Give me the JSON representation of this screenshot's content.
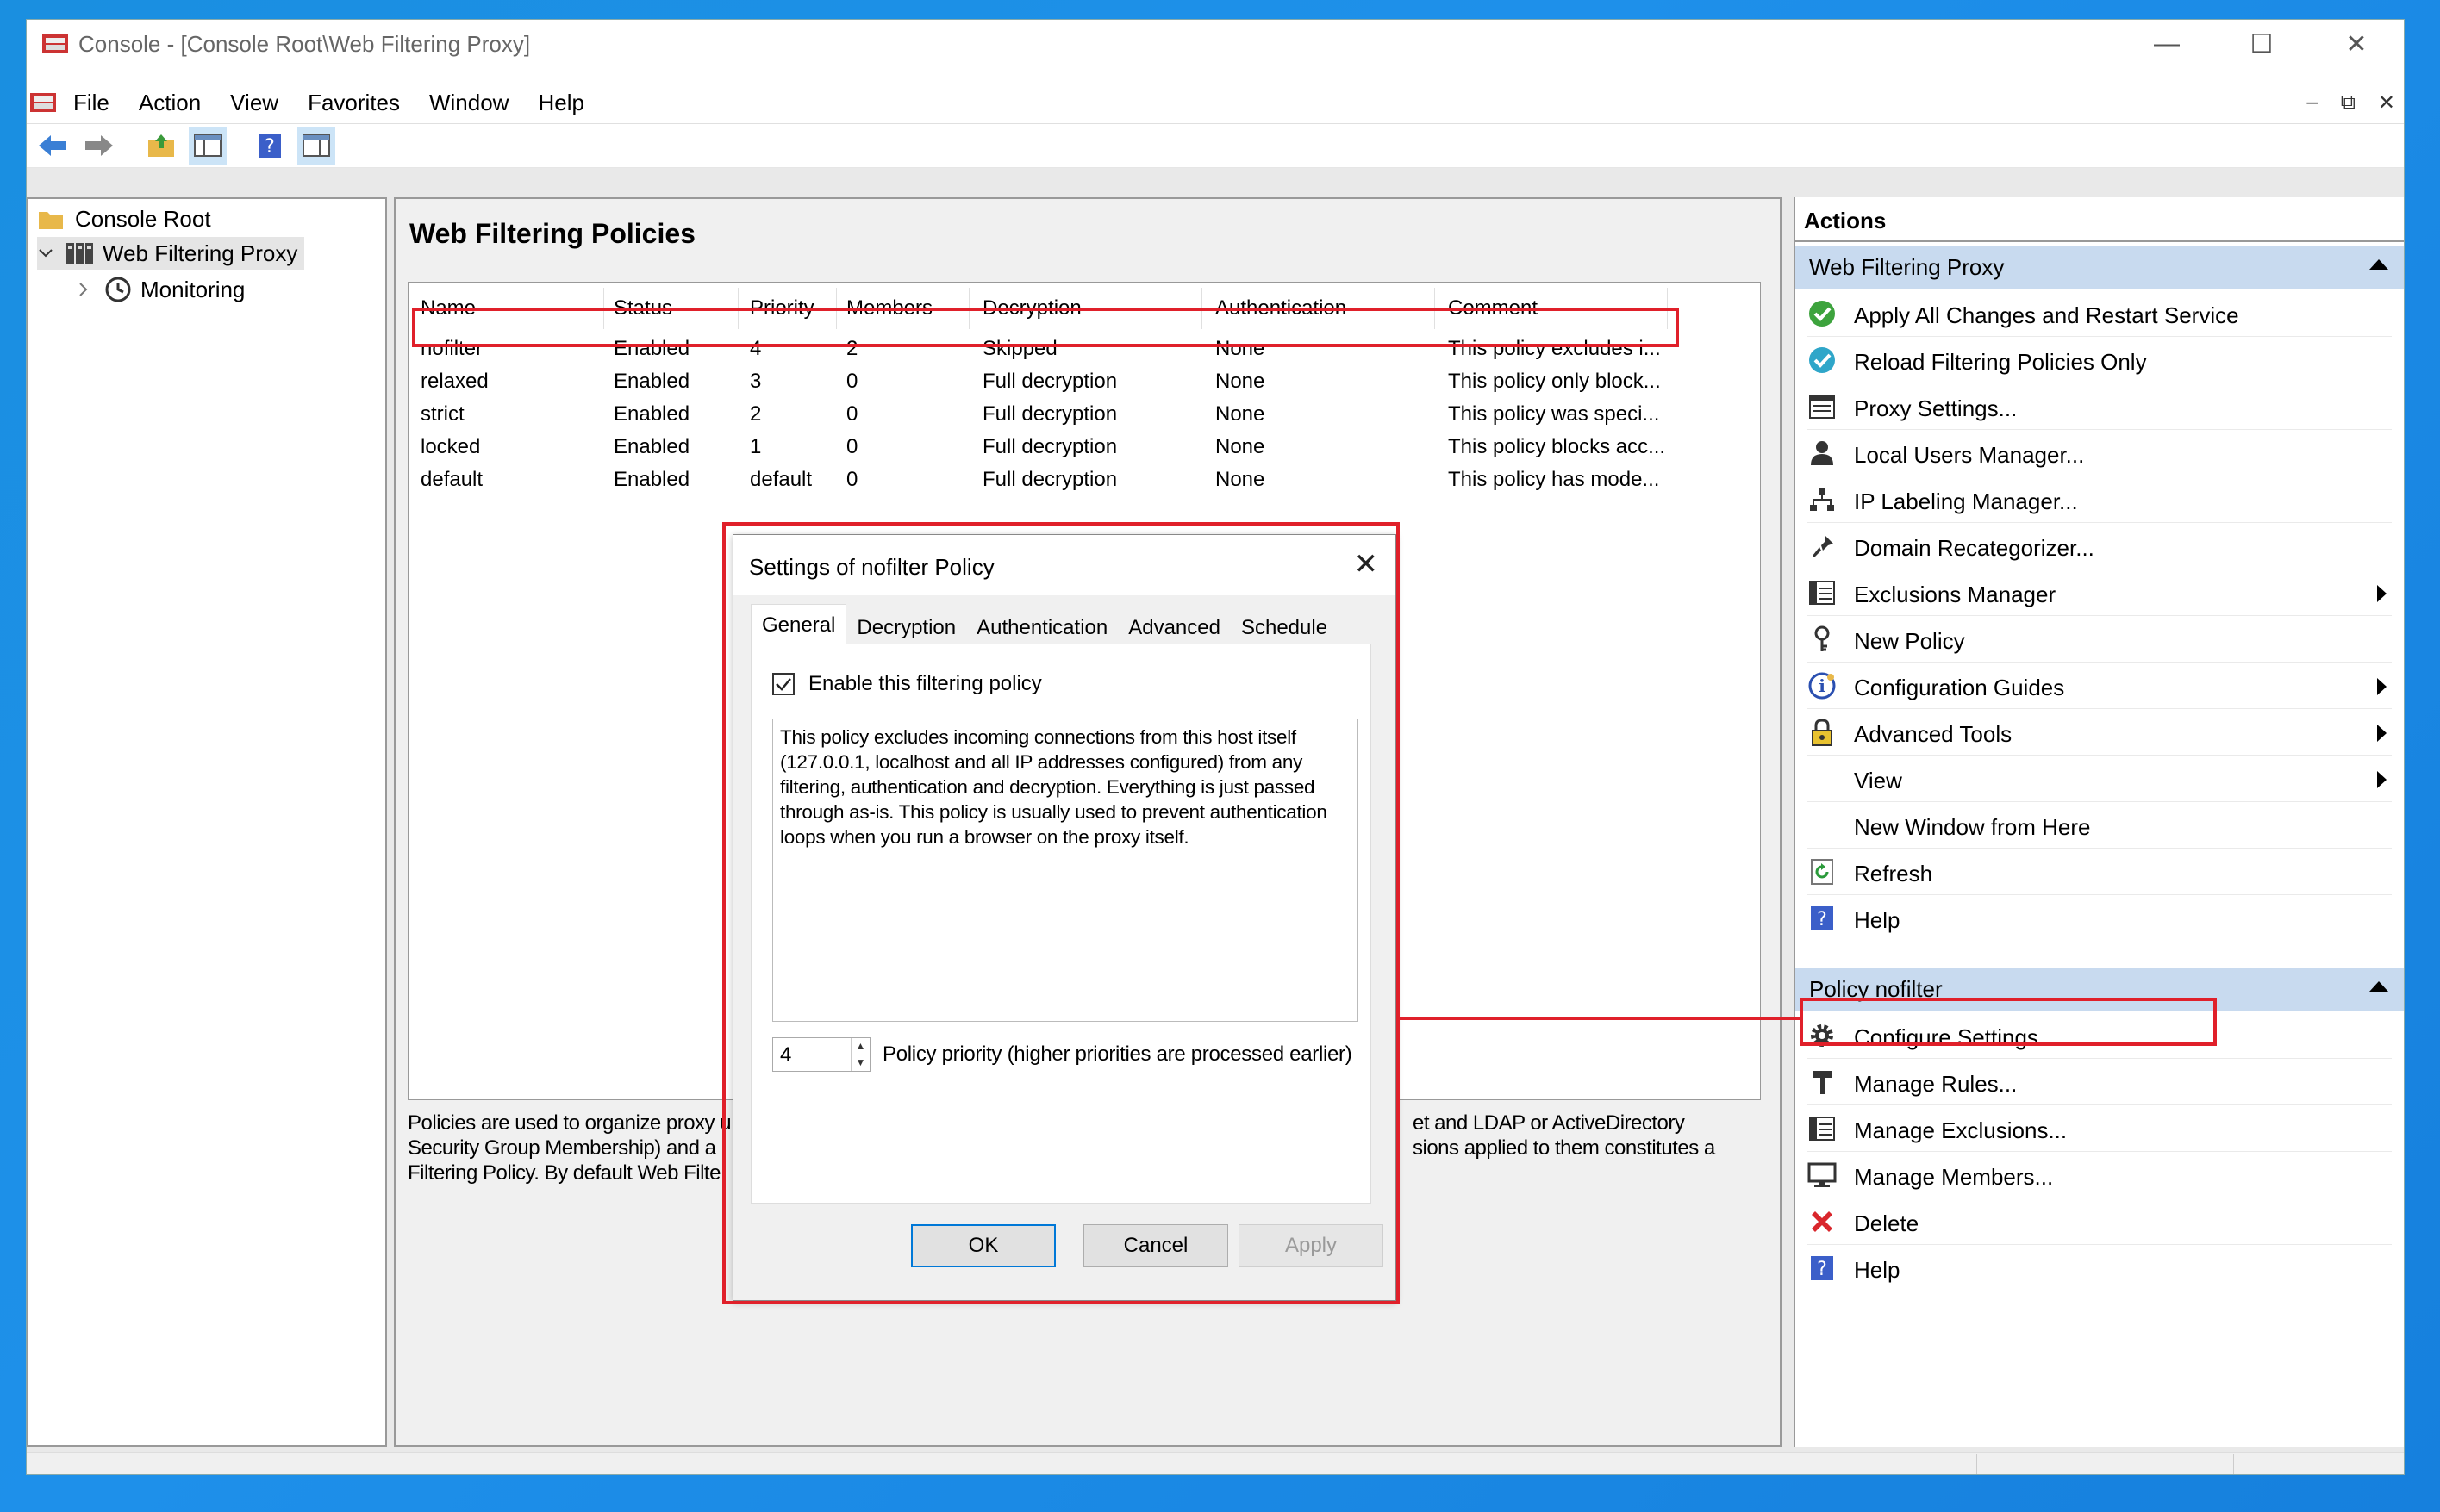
{
  "window": {
    "title": "Console - [Console Root\\Web Filtering Proxy]"
  },
  "menu": [
    "File",
    "Action",
    "View",
    "Favorites",
    "Window",
    "Help"
  ],
  "tree": {
    "root": "Console Root",
    "child": "Web Filtering Proxy",
    "grandchild": "Monitoring"
  },
  "center": {
    "title": "Web Filtering Policies",
    "columns": [
      "Name",
      "Status",
      "Priority",
      "Members",
      "Decryption",
      "Authentication",
      "Comment"
    ],
    "rows": [
      [
        "nofilter",
        "Enabled",
        "4",
        "2",
        "Skipped",
        "None",
        "This policy excludes i..."
      ],
      [
        "relaxed",
        "Enabled",
        "3",
        "0",
        "Full decryption",
        "None",
        "This policy only block..."
      ],
      [
        "strict",
        "Enabled",
        "2",
        "0",
        "Full decryption",
        "None",
        "This policy was speci..."
      ],
      [
        "locked",
        "Enabled",
        "1",
        "0",
        "Full decryption",
        "None",
        "This policy blocks acc..."
      ],
      [
        "default",
        "Enabled",
        "default",
        "0",
        "Full decryption",
        "None",
        "This policy has mode..."
      ]
    ],
    "description_left": [
      "Policies are used to organize proxy u",
      "Security Group Membership) and a",
      "Filtering Policy. By default Web Filte"
    ],
    "description_right": [
      "et and LDAP or ActiveDirectory",
      "sions applied to them constitutes a"
    ]
  },
  "actions": {
    "header": "Actions",
    "section1": {
      "title": "Web Filtering Proxy",
      "items": [
        {
          "label": "Apply All Changes and Restart Service",
          "icon": "apply-check-icon"
        },
        {
          "label": "Reload Filtering Policies Only",
          "icon": "reload-icon"
        },
        {
          "label": "Proxy Settings...",
          "icon": "settings-sheet-icon"
        },
        {
          "label": "Local Users Manager...",
          "icon": "user-icon"
        },
        {
          "label": "IP Labeling Manager...",
          "icon": "network-icon"
        },
        {
          "label": "Domain Recategorizer...",
          "icon": "pin-icon"
        },
        {
          "label": "Exclusions Manager",
          "icon": "list-icon"
        },
        {
          "label": "New Policy",
          "icon": "key-icon"
        },
        {
          "label": "Configuration Guides",
          "icon": "info-icon"
        },
        {
          "label": "Advanced Tools",
          "icon": "lock-icon"
        },
        {
          "label": "View",
          "icon": ""
        },
        {
          "label": "New Window from Here",
          "icon": ""
        },
        {
          "label": "Refresh",
          "icon": "refresh-icon"
        },
        {
          "label": "Help",
          "icon": "help-icon"
        }
      ]
    },
    "section2": {
      "title": "Policy nofilter",
      "items": [
        {
          "label": "Configure Settings...",
          "icon": "gear-icon"
        },
        {
          "label": "Manage Rules...",
          "icon": "hammer-icon"
        },
        {
          "label": "Manage Exclusions...",
          "icon": "list-icon"
        },
        {
          "label": "Manage Members...",
          "icon": "monitor-icon"
        },
        {
          "label": "Delete",
          "icon": "delete-x-icon"
        },
        {
          "label": "Help",
          "icon": "help-icon"
        }
      ]
    }
  },
  "dialog": {
    "title": "Settings of nofilter Policy",
    "tabs": [
      "General",
      "Decryption",
      "Authentication",
      "Advanced",
      "Schedule"
    ],
    "enable_label": "Enable this filtering policy",
    "comment": "This policy excludes incoming connections from this host itself (127.0.0.1, localhost and all IP addresses configured) from any filtering, authentication and decryption. Everything is just passed through as-is. This policy is usually used to prevent authentication loops when you run a browser on the proxy itself.",
    "priority_value": "4",
    "priority_label": "Policy priority (higher priorities are processed earlier)",
    "ok": "OK",
    "cancel": "Cancel",
    "apply": "Apply"
  },
  "colors": {
    "highlight": "#e0202a",
    "section_bg": "#c8daef",
    "selection": "#cce4f7"
  }
}
